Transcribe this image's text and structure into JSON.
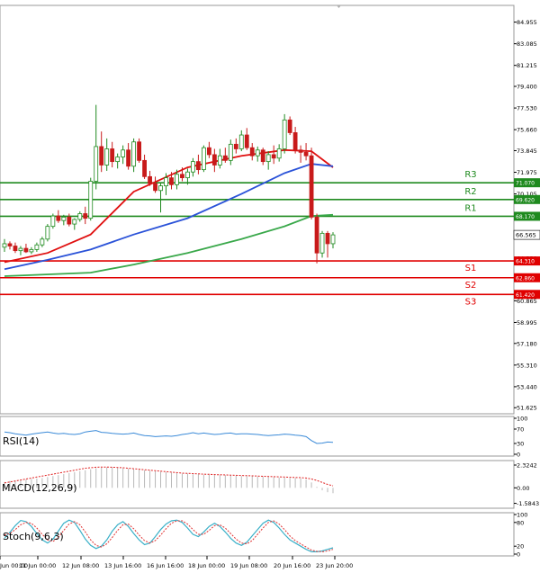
{
  "chart_data": {
    "type": "candlestick",
    "colors": {
      "up": "#1f8a1f",
      "down": "#c81a1a",
      "resistance": "#1f8a1f",
      "support": "#e00000",
      "ma_fast": "#e01010",
      "ma_mid": "#2a52d8",
      "ma_slow": "#39a84a",
      "rsi": "#3a8ad8",
      "macd_hist": "#b8b8b8",
      "macd_signal": "#e02020",
      "stoch_main": "#3ab0c8",
      "stoch_signal": "#e03030"
    },
    "price_axis": {
      "ticks": [
        "84.955",
        "83.085",
        "81.215",
        "79.400",
        "77.530",
        "75.660",
        "73.845",
        "71.975",
        "70.105",
        "68.235",
        "66.420",
        "64.550",
        "62.680",
        "60.865",
        "58.995",
        "57.180",
        "55.310",
        "53.440",
        "51.625"
      ],
      "range": [
        51.1,
        86.4
      ],
      "current_price": "66.565"
    },
    "levels": [
      {
        "name": "R3",
        "value": 71.07,
        "label": "71.070",
        "type": "resistance"
      },
      {
        "name": "R2",
        "value": 69.62,
        "label": "69.620",
        "type": "resistance"
      },
      {
        "name": "R1",
        "value": 68.17,
        "label": "68.170",
        "type": "resistance"
      },
      {
        "name": "S1",
        "value": 64.31,
        "label": "64.310",
        "type": "support"
      },
      {
        "name": "S2",
        "value": 62.86,
        "label": "62.860",
        "type": "support"
      },
      {
        "name": "S3",
        "value": 61.42,
        "label": "61.420",
        "type": "support"
      }
    ],
    "time_axis": [
      "Jun 00:00",
      "11 Jun 00:00",
      "12 Jun 08:00",
      "13 Jun 16:00",
      "16 Jun 16:00",
      "18 Jun 00:00",
      "19 Jun 08:00",
      "20 Jun 16:00",
      "23 Jun 20:00"
    ],
    "candles": [
      [
        65.5,
        66.2,
        65.1,
        65.8
      ],
      [
        65.8,
        66.0,
        65.3,
        65.6
      ],
      [
        65.6,
        65.9,
        65.0,
        65.2
      ],
      [
        65.2,
        65.6,
        64.8,
        65.4
      ],
      [
        65.4,
        65.8,
        65.0,
        65.1
      ],
      [
        65.1,
        65.5,
        64.9,
        65.3
      ],
      [
        65.3,
        65.9,
        65.1,
        65.7
      ],
      [
        65.7,
        66.4,
        65.5,
        66.2
      ],
      [
        66.2,
        67.5,
        66.0,
        67.3
      ],
      [
        67.3,
        68.4,
        67.1,
        68.2
      ],
      [
        68.2,
        68.7,
        67.6,
        67.8
      ],
      [
        67.8,
        68.3,
        67.4,
        68.1
      ],
      [
        68.1,
        68.4,
        67.3,
        67.5
      ],
      [
        67.5,
        68.0,
        67.0,
        67.9
      ],
      [
        67.9,
        68.6,
        67.7,
        68.4
      ],
      [
        68.4,
        69.0,
        67.5,
        68.0
      ],
      [
        68.0,
        71.5,
        67.8,
        71.2
      ],
      [
        71.2,
        77.8,
        70.5,
        74.2
      ],
      [
        74.2,
        75.5,
        72.0,
        72.6
      ],
      [
        72.6,
        74.9,
        72.1,
        74.0
      ],
      [
        74.0,
        74.6,
        72.4,
        72.9
      ],
      [
        72.9,
        73.6,
        72.3,
        73.3
      ],
      [
        73.3,
        74.3,
        72.7,
        73.9
      ],
      [
        73.9,
        74.5,
        72.2,
        72.5
      ],
      [
        72.5,
        74.9,
        72.0,
        74.6
      ],
      [
        74.6,
        74.9,
        72.8,
        73.0
      ],
      [
        73.0,
        73.5,
        71.4,
        71.6
      ],
      [
        71.6,
        72.1,
        70.8,
        71.0
      ],
      [
        71.0,
        71.6,
        70.2,
        70.4
      ],
      [
        70.4,
        71.0,
        68.5,
        70.8
      ],
      [
        70.8,
        71.9,
        70.0,
        71.5
      ],
      [
        71.5,
        72.0,
        70.5,
        70.9
      ],
      [
        70.9,
        72.2,
        70.5,
        71.8
      ],
      [
        71.8,
        72.4,
        71.2,
        71.5
      ],
      [
        71.5,
        72.3,
        70.9,
        72.0
      ],
      [
        72.0,
        73.2,
        71.6,
        72.9
      ],
      [
        72.9,
        73.5,
        71.8,
        72.2
      ],
      [
        72.2,
        74.3,
        72.0,
        74.1
      ],
      [
        74.1,
        74.6,
        73.2,
        73.5
      ],
      [
        73.5,
        74.0,
        72.0,
        72.6
      ],
      [
        72.6,
        74.0,
        72.3,
        73.4
      ],
      [
        73.4,
        74.1,
        72.8,
        73.0
      ],
      [
        73.0,
        74.8,
        72.6,
        74.4
      ],
      [
        74.4,
        74.9,
        73.6,
        74.0
      ],
      [
        74.0,
        75.6,
        73.8,
        75.2
      ],
      [
        75.2,
        75.8,
        73.9,
        74.1
      ],
      [
        74.1,
        74.5,
        73.0,
        73.4
      ],
      [
        73.4,
        74.2,
        72.9,
        73.9
      ],
      [
        73.9,
        74.1,
        72.6,
        72.9
      ],
      [
        72.9,
        73.8,
        72.2,
        73.5
      ],
      [
        73.5,
        74.3,
        72.7,
        73.2
      ],
      [
        73.2,
        74.4,
        72.9,
        74.0
      ],
      [
        74.0,
        77.0,
        73.6,
        76.5
      ],
      [
        76.5,
        76.8,
        75.2,
        75.4
      ],
      [
        75.4,
        75.9,
        73.6,
        73.9
      ],
      [
        73.9,
        74.3,
        72.8,
        73.7
      ],
      [
        73.7,
        74.5,
        73.0,
        73.4
      ],
      [
        73.4,
        74.1,
        67.9,
        68.1
      ],
      [
        68.1,
        68.4,
        64.1,
        65.0
      ],
      [
        65.0,
        66.9,
        64.6,
        66.7
      ],
      [
        66.7,
        66.9,
        64.6,
        65.8
      ],
      [
        65.8,
        66.8,
        65.4,
        66.565
      ]
    ],
    "moving_averages": [
      {
        "color_key": "ma_fast",
        "points": [
          [
            0,
            64.2
          ],
          [
            8,
            65.0
          ],
          [
            16,
            66.6
          ],
          [
            24,
            70.3
          ],
          [
            34,
            72.4
          ],
          [
            44,
            73.4
          ],
          [
            52,
            73.9
          ],
          [
            57,
            73.8
          ],
          [
            61,
            72.4
          ]
        ]
      },
      {
        "color_key": "ma_mid",
        "points": [
          [
            0,
            63.6
          ],
          [
            8,
            64.4
          ],
          [
            16,
            65.3
          ],
          [
            24,
            66.6
          ],
          [
            34,
            68.0
          ],
          [
            44,
            70.1
          ],
          [
            52,
            71.9
          ],
          [
            57,
            72.7
          ],
          [
            61,
            72.5
          ]
        ]
      },
      {
        "color_key": "ma_slow",
        "points": [
          [
            0,
            63.0
          ],
          [
            16,
            63.3
          ],
          [
            24,
            64.0
          ],
          [
            34,
            65.0
          ],
          [
            44,
            66.2
          ],
          [
            52,
            67.3
          ],
          [
            57,
            68.2
          ],
          [
            61,
            68.3
          ]
        ]
      }
    ],
    "indicators": [
      {
        "name": "RSI(14)",
        "axis_ticks": [
          "100",
          "70",
          "30",
          "0"
        ],
        "range": [
          0,
          100
        ],
        "values": [
          62,
          60,
          57,
          55,
          53,
          56,
          58,
          60,
          62,
          59,
          57,
          58,
          56,
          55,
          57,
          62,
          64,
          66,
          61,
          60,
          58,
          57,
          56,
          57,
          59,
          55,
          52,
          51,
          49,
          50,
          51,
          50,
          52,
          55,
          57,
          60,
          57,
          59,
          57,
          55,
          56,
          58,
          59,
          56,
          57,
          57,
          56,
          55,
          53,
          52,
          53,
          54,
          56,
          55,
          53,
          52,
          49,
          38,
          30,
          31,
          34,
          33
        ]
      },
      {
        "name": "MACD(12,26,9)",
        "axis_ticks": [
          "2.3242",
          "0.00",
          "-1.5843"
        ],
        "range": [
          -1.9,
          2.6
        ],
        "histogram": [
          0.6,
          0.7,
          0.75,
          0.8,
          0.85,
          0.9,
          0.95,
          1.0,
          1.1,
          1.2,
          1.3,
          1.4,
          1.5,
          1.6,
          1.7,
          1.8,
          1.9,
          2.0,
          2.05,
          2.1,
          2.1,
          2.05,
          2.0,
          1.95,
          1.9,
          1.85,
          1.8,
          1.75,
          1.7,
          1.65,
          1.6,
          1.55,
          1.5,
          1.45,
          1.45,
          1.4,
          1.4,
          1.35,
          1.35,
          1.3,
          1.3,
          1.3,
          1.25,
          1.25,
          1.2,
          1.2,
          1.2,
          1.15,
          1.15,
          1.1,
          1.1,
          1.05,
          1.05,
          1.0,
          1.0,
          0.95,
          0.85,
          0.55,
          0.1,
          -0.25,
          -0.45,
          -0.55
        ],
        "signal": [
          0.5,
          0.6,
          0.7,
          0.8,
          0.9,
          1.0,
          1.1,
          1.2,
          1.3,
          1.4,
          1.5,
          1.6,
          1.7,
          1.8,
          1.9,
          2.0,
          2.05,
          2.1,
          2.12,
          2.12,
          2.1,
          2.08,
          2.05,
          2.0,
          1.95,
          1.9,
          1.85,
          1.8,
          1.75,
          1.7,
          1.65,
          1.6,
          1.55,
          1.5,
          1.48,
          1.45,
          1.42,
          1.4,
          1.38,
          1.35,
          1.33,
          1.31,
          1.3,
          1.28,
          1.26,
          1.24,
          1.22,
          1.2,
          1.18,
          1.16,
          1.14,
          1.12,
          1.1,
          1.08,
          1.06,
          1.04,
          1.0,
          0.9,
          0.75,
          0.55,
          0.35,
          0.2
        ]
      },
      {
        "name": "Stoch(9,6,3)",
        "axis_ticks": [
          "100",
          "80",
          "20",
          "0"
        ],
        "range": [
          0,
          100
        ],
        "main": [
          40,
          55,
          72,
          85,
          82,
          70,
          52,
          36,
          28,
          38,
          58,
          78,
          86,
          80,
          60,
          38,
          22,
          14,
          20,
          36,
          58,
          74,
          82,
          70,
          52,
          36,
          24,
          28,
          44,
          62,
          76,
          84,
          86,
          80,
          66,
          50,
          44,
          56,
          70,
          78,
          70,
          56,
          40,
          28,
          22,
          30,
          46,
          62,
          78,
          86,
          80,
          66,
          50,
          36,
          28,
          20,
          12,
          6,
          6,
          8,
          12,
          16
        ],
        "signal": [
          48,
          52,
          62,
          74,
          80,
          78,
          66,
          50,
          36,
          32,
          42,
          60,
          76,
          82,
          74,
          56,
          36,
          22,
          18,
          26,
          42,
          60,
          74,
          76,
          64,
          48,
          34,
          28,
          34,
          48,
          64,
          78,
          84,
          84,
          76,
          62,
          50,
          50,
          60,
          72,
          74,
          66,
          52,
          38,
          28,
          26,
          34,
          50,
          66,
          80,
          84,
          76,
          62,
          46,
          34,
          26,
          18,
          10,
          7,
          6,
          8,
          12
        ]
      }
    ]
  }
}
